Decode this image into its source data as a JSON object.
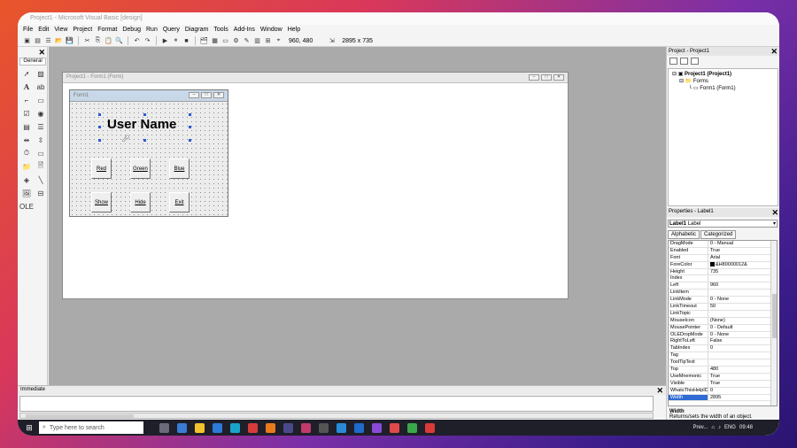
{
  "window": {
    "title": "Project1 - Microsoft Visual Basic [design]"
  },
  "menu": [
    "File",
    "Edit",
    "View",
    "Project",
    "Format",
    "Debug",
    "Run",
    "Query",
    "Diagram",
    "Tools",
    "Add-Ins",
    "Window",
    "Help"
  ],
  "toolbar": {
    "position": "960, 480",
    "size": "2895 x 735"
  },
  "toolbox": {
    "title": "General",
    "close": "✕"
  },
  "designer": {
    "title": "Project1 - Form1 (Form)",
    "form_title": "Form1",
    "label_caption": "User Name",
    "buttons": {
      "red": "Red",
      "green": "Green",
      "blue": "Blue",
      "show": "Show",
      "hide": "Hide",
      "exit": "Exit"
    }
  },
  "project": {
    "title": "Project - Project1",
    "root": "Project1 (Project1)",
    "folder": "Forms",
    "form": "Form1 (Form1)"
  },
  "properties": {
    "title": "Properties - Label1",
    "object_name": "Label1",
    "object_type": "Label",
    "tabs": [
      "Alphabetic",
      "Categorized"
    ],
    "rows": [
      {
        "name": "DragMode",
        "value": "0 - Manual"
      },
      {
        "name": "Enabled",
        "value": "True"
      },
      {
        "name": "Font",
        "value": "Arial"
      },
      {
        "name": "ForeColor",
        "value": "&H80000012&"
      },
      {
        "name": "Height",
        "value": "735"
      },
      {
        "name": "Index",
        "value": ""
      },
      {
        "name": "Left",
        "value": "960"
      },
      {
        "name": "LinkItem",
        "value": ""
      },
      {
        "name": "LinkMode",
        "value": "0 - None"
      },
      {
        "name": "LinkTimeout",
        "value": "50"
      },
      {
        "name": "LinkTopic",
        "value": ""
      },
      {
        "name": "MouseIcon",
        "value": "(None)"
      },
      {
        "name": "MousePointer",
        "value": "0 - Default"
      },
      {
        "name": "OLEDropMode",
        "value": "0 - None"
      },
      {
        "name": "RightToLeft",
        "value": "False"
      },
      {
        "name": "TabIndex",
        "value": "0"
      },
      {
        "name": "Tag",
        "value": ""
      },
      {
        "name": "ToolTipText",
        "value": ""
      },
      {
        "name": "Top",
        "value": "480"
      },
      {
        "name": "UseMnemonic",
        "value": "True"
      },
      {
        "name": "Visible",
        "value": "True"
      },
      {
        "name": "WhatsThisHelpID",
        "value": "0"
      },
      {
        "name": "Width",
        "value": "2895"
      }
    ],
    "desc_title": "Width",
    "desc_text": "Returns/sets the width of an object."
  },
  "immediate": {
    "title": "Immediate"
  },
  "taskbar": {
    "search_placeholder": "Type here to search",
    "clock": "09:48",
    "lang": "ENG",
    "preview": "Prev..."
  }
}
